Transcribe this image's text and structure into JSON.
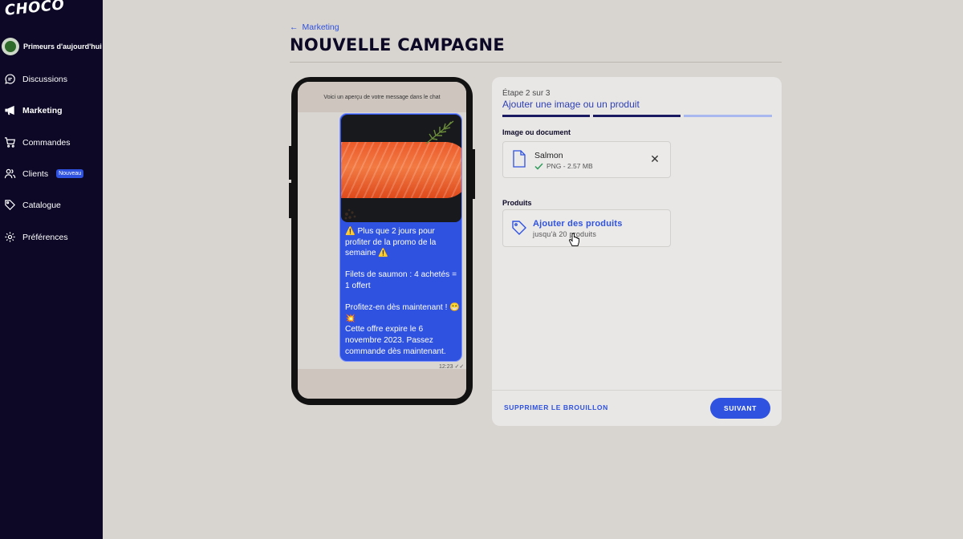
{
  "sidebar": {
    "logo": "CHOCO",
    "shop_name": "Primeurs d'aujourd'hui",
    "items": [
      {
        "label": "Discussions",
        "icon": "chat-bubble-icon"
      },
      {
        "label": "Marketing",
        "icon": "megaphone-icon",
        "active": true
      },
      {
        "label": "Commandes",
        "icon": "cart-icon"
      },
      {
        "label": "Clients",
        "icon": "users-icon",
        "badge": "Nouveau"
      },
      {
        "label": "Catalogue",
        "icon": "tag-icon"
      },
      {
        "label": "Préférences",
        "icon": "gear-icon"
      }
    ]
  },
  "header": {
    "breadcrumb": "Marketing",
    "title": "NOUVELLE CAMPAGNE"
  },
  "phone": {
    "preview_caption": "Voici un aperçu de votre message dans le chat",
    "message": "⚠️ Plus que 2 jours pour profiter de la promo de la semaine ⚠️\n\nFilets de saumon : 4 achetés = 1 offert\n\nProfitez-en dès maintenant ! 😁💥\nCette offre expire le 6 novembre 2023. Passez commande dès maintenant.",
    "time": "12:23"
  },
  "panel": {
    "step_label": "Étape 2 sur 3",
    "step_title": "Ajouter une image ou un produit",
    "progress": {
      "current": 2,
      "total": 3
    },
    "colors": {
      "done": "#1a1a63",
      "pending": "#a9b8ee",
      "accent": "#2f52e0"
    },
    "image_section_label": "Image ou document",
    "file": {
      "name": "Salmon",
      "meta": "PNG - 2.57 MB"
    },
    "products_section_label": "Produits",
    "add_products": {
      "title": "Ajouter des produits",
      "subtitle": "jusqu'à 20 produits"
    },
    "delete_draft_label": "SUPPRIMER LE BROUILLON",
    "next_label": "SUIVANT"
  }
}
